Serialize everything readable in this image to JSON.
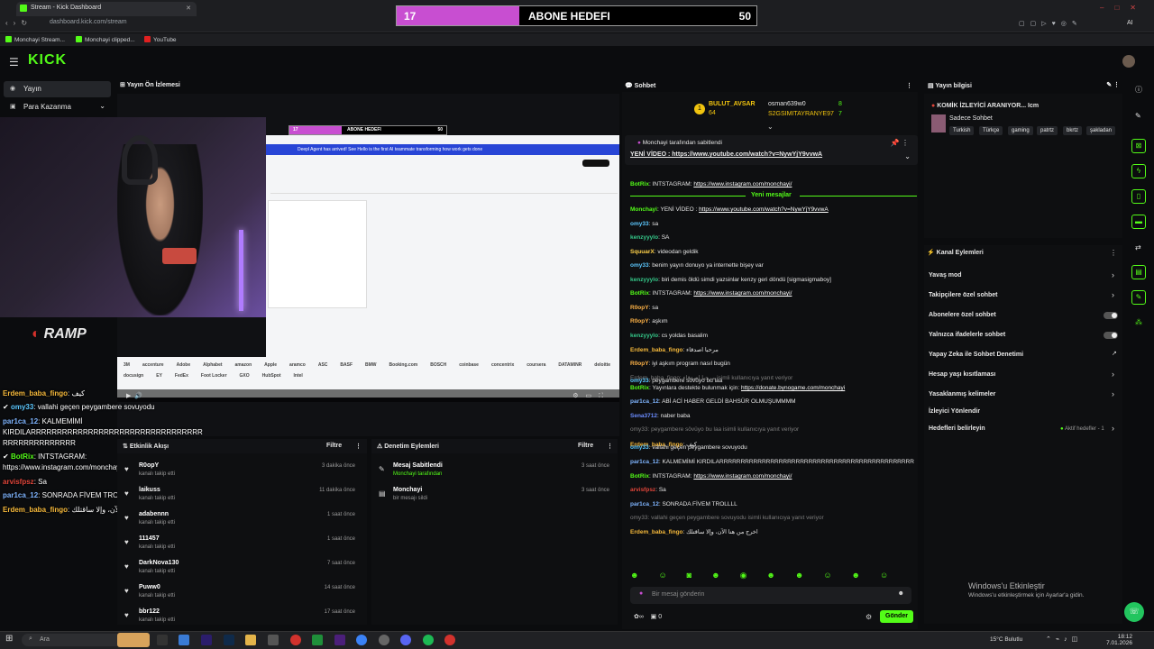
{
  "browser": {
    "tab_title": "Stream - Kick Dashboard",
    "url": "dashboard.kick.com/stream",
    "bookmarks": [
      "Monchayi Stream...",
      "Monchayi clipped...",
      "YouTube"
    ],
    "ai_label": "AI"
  },
  "goal": {
    "current": "17",
    "title": "ABONE HEDEFI",
    "target": "50",
    "progress": 0.34
  },
  "header": {
    "logo": "KICK"
  },
  "nav": {
    "items": [
      {
        "label": "Yayın",
        "active": true
      },
      {
        "label": "Para Kazanma",
        "active": false
      }
    ]
  },
  "preview": {
    "title": "Yayın Ön İzlemesi",
    "brand": "RAMP",
    "banner": "Deepl Agent has arrived! See Hello is the first AI teammate transforming how work gets done",
    "logos": [
      "3M",
      "accenture",
      "Adobe",
      "Alphabet",
      "amazon",
      "Apple",
      "aramco",
      "ASC",
      "BASF",
      "BMW",
      "Booking.com",
      "BOSCH",
      "coinbase",
      "concentrix",
      "coursera",
      "DATAMINR",
      "deloitte",
      "docusign",
      "EY",
      "FedEx",
      "Foot Locker",
      "GXO",
      "HubSpot",
      "Intel"
    ]
  },
  "overlay_chat": [
    {
      "user": "Erdem_baba_fingo",
      "msg": "كيف",
      "color": "#f6b93b"
    },
    {
      "user": "omy33",
      "msg": "vallahi geçen peygambere sovuyodu",
      "color": "#5cc8ff"
    },
    {
      "user": "par1ca_12",
      "msg": "KALMEMİMİ",
      "color": "#7fb5ff"
    },
    {
      "user": "",
      "msg": "KIRDILARRRRRRRRRRRRRRRRRRRRRRRRRRRRRRRRR",
      "color": "#fff"
    },
    {
      "user": "",
      "msg": "RRRRRRRRRRRRRR",
      "color": "#fff"
    },
    {
      "user": "BotRix",
      "msg": "INTSTAGRAM:",
      "color": "#53fc18"
    },
    {
      "user": "",
      "msg": "https://www.instagram.com/monchayi/",
      "color": "#fff"
    },
    {
      "user": "arvisfpsz",
      "msg": "Sa",
      "color": "#e0453a"
    },
    {
      "user": "par1ca_12",
      "msg": "SONRADA FİVEM TROLLLL",
      "color": "#7fb5ff"
    },
    {
      "user": "Erdem_baba_fingo",
      "msg": "اخرج من هنا الآن، وإلا ساقتلك",
      "color": "#f6b93b"
    }
  ],
  "activity": {
    "title": "Etkinlik Akışı",
    "filter": "Filtre",
    "events": [
      {
        "name": "R0opY",
        "sub": "kanalı takip etti",
        "time": "3 dakika önce"
      },
      {
        "name": "laikuss",
        "sub": "kanalı takip etti",
        "time": "11 dakika önce"
      },
      {
        "name": "adabennn",
        "sub": "kanalı takip etti",
        "time": "1 saat önce"
      },
      {
        "name": "111457",
        "sub": "kanalı takip etti",
        "time": "1 saat önce"
      },
      {
        "name": "DarkNova130",
        "sub": "kanalı takip etti",
        "time": "7 saat önce"
      },
      {
        "name": "Puww0",
        "sub": "kanalı takip etti",
        "time": "14 saat önce"
      },
      {
        "name": "bbr122",
        "sub": "kanalı takip etti",
        "time": "17 saat önce"
      }
    ]
  },
  "moderation": {
    "title": "Denetim Eylemleri",
    "filter": "Filtre",
    "events": [
      {
        "name": "Mesaj Sabitlendi",
        "sub": "Monchayi tarafından",
        "time": "3 saat önce"
      },
      {
        "name": "Monchayi",
        "sub": "bir mesajı sildi",
        "time": "3 saat önce"
      }
    ]
  },
  "chat": {
    "title": "Sohbet",
    "top": [
      {
        "name": "BULUT_AVSAR",
        "count": "64"
      },
      {
        "name": "osman639w0",
        "count": "8"
      },
      {
        "name": "S2GSIMITAYRANYE97",
        "count": "7"
      }
    ],
    "pinned_by": "Monchayi tarafından sabitlendi",
    "pinned_msg": "YENİ VİDEO : https://www.youtube.com/watch?v=NywYjY9vvwA",
    "new_messages": "Yeni mesajlar",
    "messages": [
      {
        "user": "BotRix",
        "msg": "INTSTAGRAM: ",
        "link": "https://www.instagram.com/monchayi/",
        "color": "#53fc18"
      },
      {
        "user": "Monchayi",
        "msg": "YENİ VİDEO : ",
        "link": "https://www.youtube.com/watch?v=NywYjY9vvwA",
        "color": "#53fc18"
      },
      {
        "user": "omy33",
        "msg": "sa",
        "link": "",
        "color": "#5cc8ff"
      },
      {
        "user": "kenzyyylo",
        "msg": "SA",
        "link": "",
        "color": "#35c98a"
      },
      {
        "user": "SquuarX",
        "msg": "videodan geldik",
        "link": "",
        "color": "#ffd24a"
      },
      {
        "user": "omy33",
        "msg": "benim yayın donuyo ya internette bişey var",
        "link": "",
        "color": "#5cc8ff"
      },
      {
        "user": "kenzyyylo",
        "msg": "biri demis öldü simdi yazsinlar kenzy geri döndü [sigmasigmaboy]",
        "link": "",
        "color": "#35c98a"
      },
      {
        "user": "BotRix",
        "msg": "INTSTAGRAM: ",
        "link": "https://www.instagram.com/monchayi/",
        "color": "#53fc18"
      },
      {
        "user": "R0opY",
        "msg": "sa",
        "link": "",
        "color": "#ffb347"
      },
      {
        "user": "R0opY",
        "msg": "aşkım",
        "link": "",
        "color": "#ffb347"
      },
      {
        "user": "kenzyyylo",
        "msg": "cs yoldas basalim",
        "link": "",
        "color": "#35c98a"
      },
      {
        "user": "Erdem_baba_fingo",
        "msg": "مرحبا اصدقاء",
        "link": "",
        "color": "#f6b93b"
      },
      {
        "user": "R0opY",
        "msg": "iyi aşkım program nasıl bugün",
        "link": "",
        "color": "#ffb347"
      },
      {
        "user": "",
        "msg": "Erdem_baba_fingo: مرحبا اصدقاء isimli kullanıcıya yanıt veriyor",
        "link": "",
        "color": "#7d7d7d"
      },
      {
        "user": "omy33",
        "msg": "peygambere sövüyo bu laa",
        "link": "",
        "color": "#5cc8ff"
      },
      {
        "user": "BotRix",
        "msg": "Yayınlara destekte bulunmak için: ",
        "link": "https://donate.bynogame.com/monchayi",
        "color": "#53fc18"
      },
      {
        "user": "par1ca_12",
        "msg": "ABİ ACİ HABER GELDİ BAHSÜR OLMUŞUMMMM",
        "link": "",
        "color": "#7fb5ff"
      },
      {
        "user": "Sena3712",
        "msg": "naber baba",
        "link": "",
        "color": "#6b8cff"
      },
      {
        "user": "",
        "msg": "omy33: peygambere sövüyo bu laa isimli kullanıcıya yanıt veriyor",
        "link": "",
        "color": "#7d7d7d"
      },
      {
        "user": "Erdem_baba_fingo",
        "msg": "كيف",
        "link": "",
        "color": "#f6b93b"
      },
      {
        "user": "omy33",
        "msg": "vallahi geçen peygambere sovuyodu",
        "link": "",
        "color": "#5cc8ff"
      },
      {
        "user": "par1ca_12",
        "msg": "KALMEMİMİ KIRDILARRRRRRRRRRRRRRRRRRRRRRRRRRRRRRRRRRRRRRRRRRRRRR",
        "link": "",
        "color": "#7fb5ff"
      },
      {
        "user": "BotRix",
        "msg": "INTSTAGRAM: ",
        "link": "https://www.instagram.com/monchayi/",
        "color": "#53fc18"
      },
      {
        "user": "arvisfpsz",
        "msg": "Sa",
        "link": "",
        "color": "#e0453a"
      },
      {
        "user": "par1ca_12",
        "msg": "SONRADA FİVEM TROLLLL",
        "link": "",
        "color": "#7fb5ff"
      },
      {
        "user": "",
        "msg": "omy33: vallahi geçen peygambere sovuyodu isimli kullanıcıya yanıt veriyor",
        "link": "",
        "color": "#7d7d7d"
      },
      {
        "user": "Erdem_baba_fingo",
        "msg": "اخرج من هنا الآن، وإلا ساقتلك",
        "link": "",
        "color": "#f6b93b"
      }
    ],
    "input_placeholder": "Bir mesaj gönderin",
    "send": "Gönder",
    "footer_count": "0"
  },
  "info": {
    "title": "Yayın bilgisi",
    "stream_title": "KOMİK İZLEYİCİ ARANIYOR... Icm",
    "category": "Sadece Sohbet",
    "tags": [
      "Turkish",
      "Türkçe",
      "gaming",
      "patrtz",
      "bkrtz",
      "şakladan"
    ]
  },
  "actions": {
    "title": "Kanal Eylemleri",
    "items": [
      "Yavaş mod",
      "Takipçilere özel sohbet",
      "Abonelere özel sohbet",
      "Yalnızca ifadelerle sohbet",
      "Yapay Zeka ile Sohbet Denetimi",
      "Hesap yaşı kısıtlaması",
      "Yasaklanmış kelimeler",
      "İzleyici Yönlendir",
      "Hedefleri belirleyin"
    ],
    "goal_badge": "Aktif hedefler - 1"
  },
  "windows": {
    "activate_title": "Windows'u Etkinleştir",
    "activate_sub": "Windows'u etkinleştirmek için Ayarlar'a gidin.",
    "search": "Ara",
    "weather": "15°C Bulutlu",
    "time": "18:12",
    "date": "7.01.2026"
  }
}
